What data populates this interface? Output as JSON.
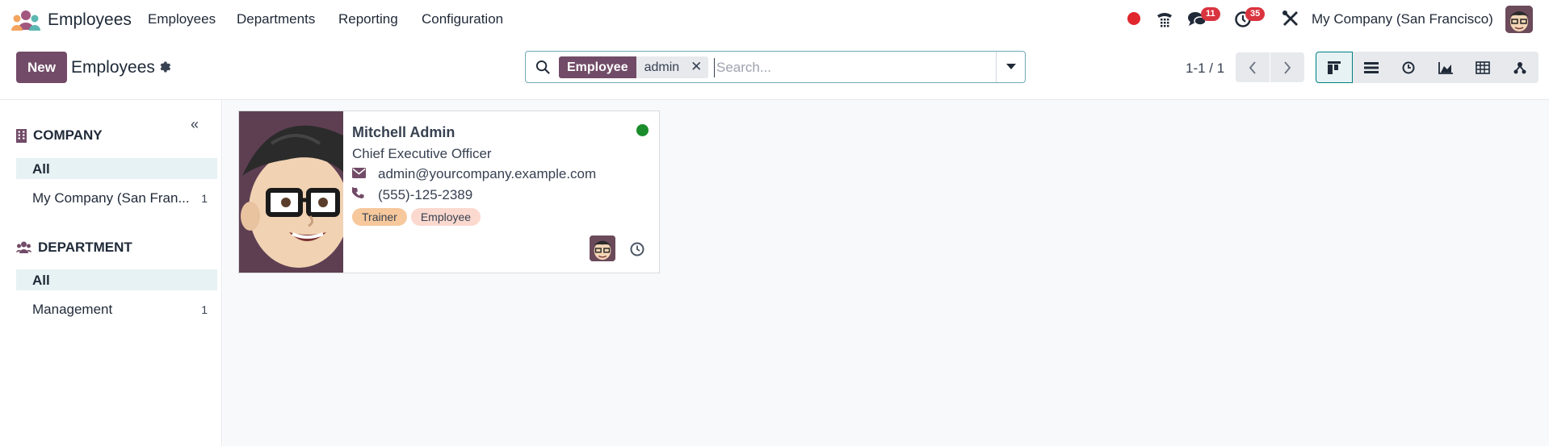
{
  "app": {
    "name": "Employees",
    "logo_icon": "odoo-employees-logo"
  },
  "nav": {
    "items": [
      "Employees",
      "Departments",
      "Reporting",
      "Configuration"
    ]
  },
  "systray": {
    "recording_color": "#e0272e",
    "messages_count": "11",
    "activities_count": "35",
    "company": "My Company (San Francisco)"
  },
  "control": {
    "new_label": "New",
    "breadcrumb": "Employees",
    "search": {
      "facet_label": "Employee",
      "facet_value": "admin",
      "placeholder": "Search..."
    },
    "pager": "1-1 / 1"
  },
  "sidebar": {
    "company": {
      "title": "COMPANY",
      "items": [
        {
          "label": "All",
          "count": ""
        },
        {
          "label": "My Company (San Fran...",
          "count": "1"
        }
      ]
    },
    "department": {
      "title": "DEPARTMENT",
      "items": [
        {
          "label": "All",
          "count": ""
        },
        {
          "label": "Management",
          "count": "1"
        }
      ]
    }
  },
  "card": {
    "name": "Mitchell Admin",
    "job": "Chief Executive Officer",
    "email": "admin@yourcompany.example.com",
    "phone": "(555)-125-2389",
    "tags": [
      {
        "label": "Trainer",
        "color": "#f6c89c"
      },
      {
        "label": "Employee",
        "color": "#fbd9cf"
      }
    ],
    "presence_color": "#198c2b"
  },
  "colors": {
    "brand": "#714b67",
    "accent": "#017e84"
  }
}
